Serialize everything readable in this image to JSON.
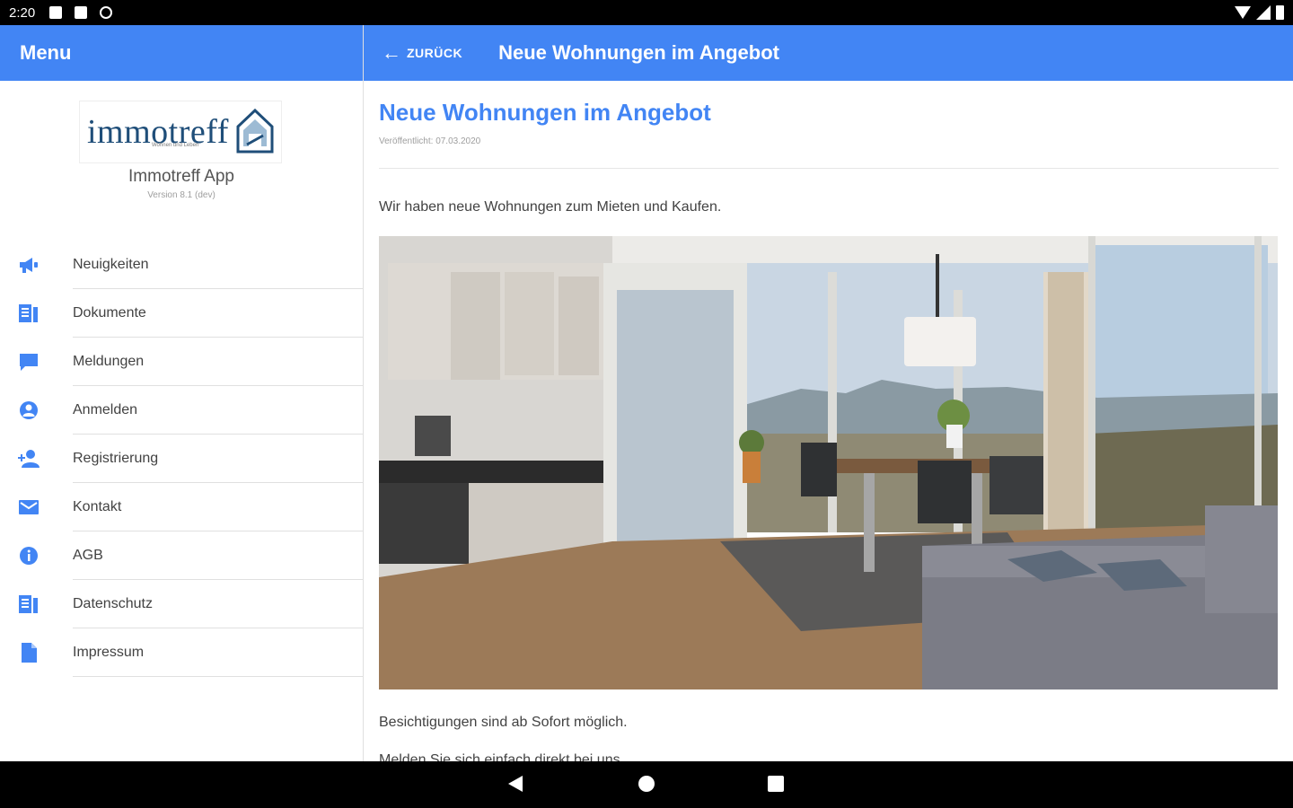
{
  "status_bar": {
    "time": "2:20",
    "icons": [
      "notification-square-icon",
      "sd-card-icon",
      "blocked-circle-icon",
      "wifi-icon",
      "signal-icon",
      "battery-icon"
    ]
  },
  "drawer": {
    "title": "Menu",
    "logo_text": "immotreff",
    "logo_tagline": "Wohnen und Leben",
    "app_name": "Immotreff App",
    "app_version": "Version 8.1 (dev)",
    "items": [
      {
        "label": "Neuigkeiten",
        "icon": "megaphone-icon"
      },
      {
        "label": "Dokumente",
        "icon": "documents-icon"
      },
      {
        "label": "Meldungen",
        "icon": "chat-bubble-icon"
      },
      {
        "label": "Anmelden",
        "icon": "account-circle-icon"
      },
      {
        "label": "Registrierung",
        "icon": "add-person-icon"
      },
      {
        "label": "Kontakt",
        "icon": "mail-icon"
      },
      {
        "label": "AGB",
        "icon": "info-icon"
      },
      {
        "label": "Datenschutz",
        "icon": "documents-icon"
      },
      {
        "label": "Impressum",
        "icon": "file-icon"
      }
    ]
  },
  "header": {
    "back_label": "ZURÜCK",
    "title": "Neue Wohnungen im Angebot"
  },
  "article": {
    "title": "Neue Wohnungen im Angebot",
    "published": "Veröffentlicht: 07.03.2020",
    "intro": "Wir haben neue Wohnungen zum Mieten und Kaufen.",
    "paragraph_1": "Besichtigungen sind ab Sofort möglich.",
    "paragraph_2": "Melden Sie sich einfach direkt bei uns."
  },
  "colors": {
    "primary": "#4285f4",
    "logo": "#1f4e79"
  }
}
